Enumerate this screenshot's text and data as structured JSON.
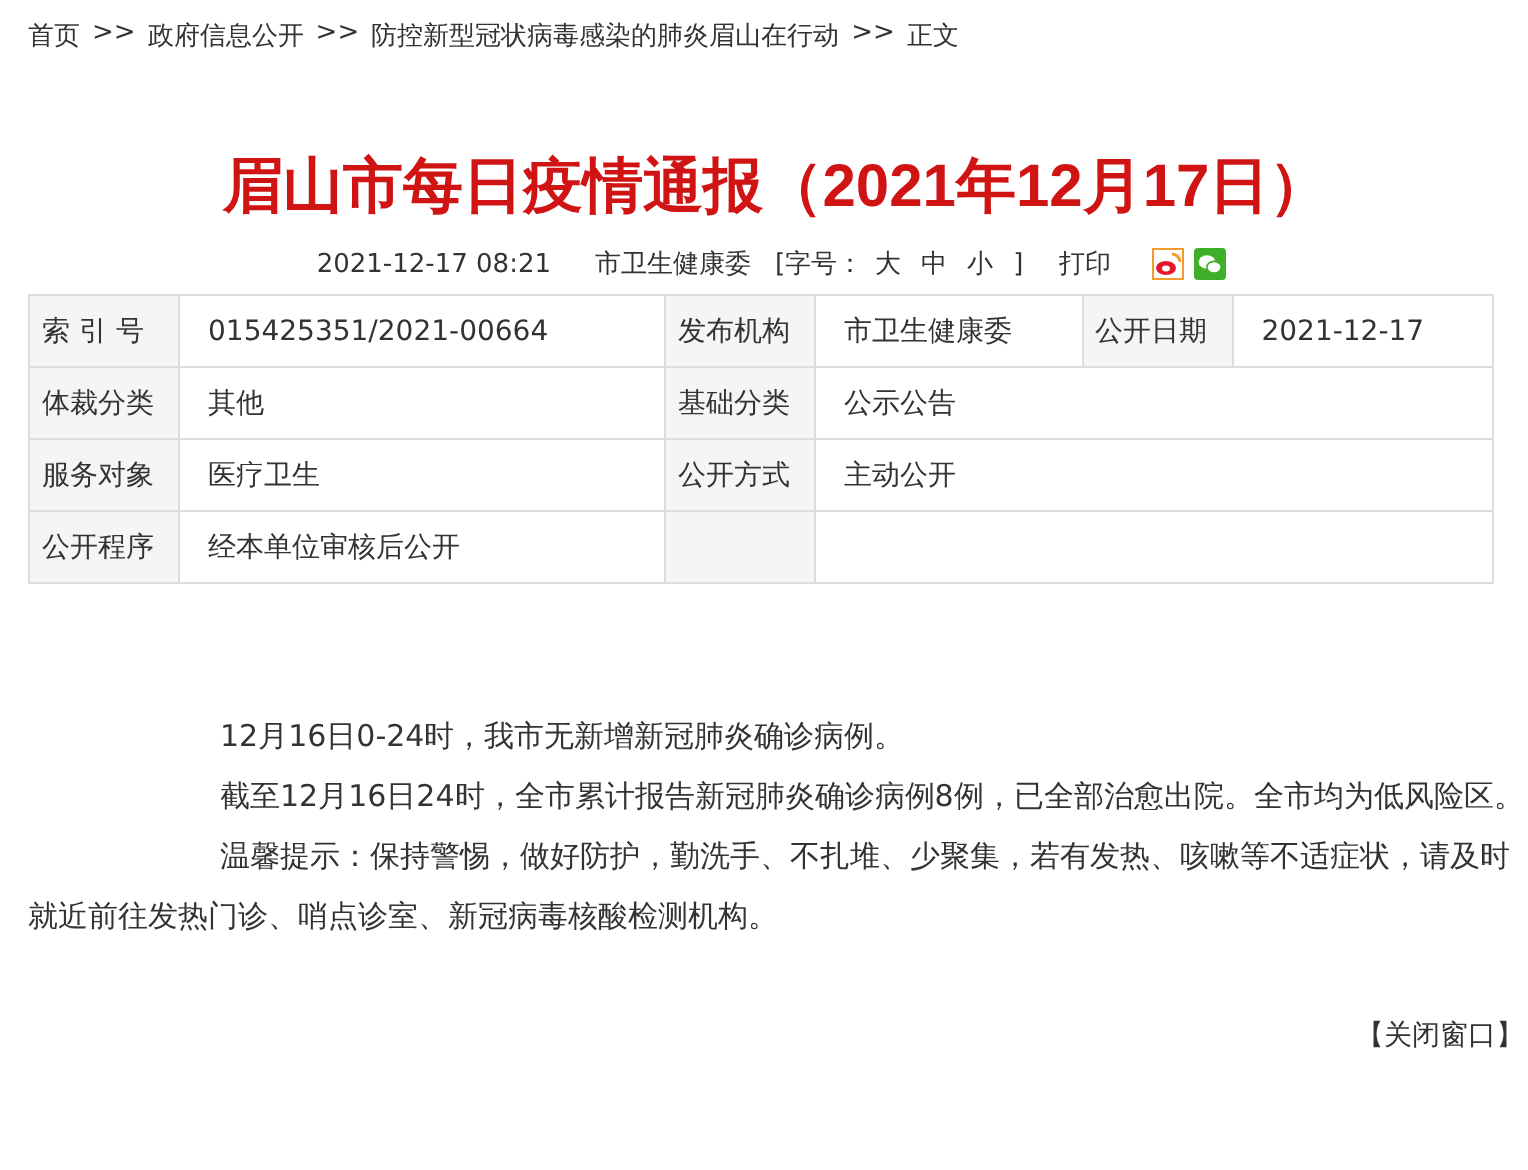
{
  "breadcrumb": [
    "首页",
    "政府信息公开",
    "防控新型冠状病毒感染的肺炎眉山在行动",
    "正文"
  ],
  "breadcrumb_separator": ">>",
  "title": "眉山市每日疫情通报（2021年12月17日）",
  "meta": {
    "datetime": "2021-12-17 08:21",
    "source": "市卫生健康委",
    "font_size_label": "[字号：",
    "font_sizes": [
      "大",
      "中",
      "小"
    ],
    "font_size_end": "]",
    "print": "打印"
  },
  "table": {
    "rows": [
      [
        {
          "kind": "label",
          "text": "索 引 号"
        },
        {
          "kind": "value",
          "text": "015425351/2021-00664"
        },
        {
          "kind": "label",
          "text": "发布机构"
        },
        {
          "kind": "value",
          "text": "市卫生健康委"
        },
        {
          "kind": "label",
          "text": "公开日期"
        },
        {
          "kind": "value",
          "text": "2021-12-17"
        }
      ],
      [
        {
          "kind": "label",
          "text": "体裁分类"
        },
        {
          "kind": "value",
          "text": "其他"
        },
        {
          "kind": "label",
          "text": "基础分类"
        },
        {
          "kind": "value",
          "text": "公示公告",
          "colspan": 3
        }
      ],
      [
        {
          "kind": "label",
          "text": "服务对象"
        },
        {
          "kind": "value",
          "text": "医疗卫生"
        },
        {
          "kind": "label",
          "text": "公开方式"
        },
        {
          "kind": "value",
          "text": "主动公开",
          "colspan": 3
        }
      ],
      [
        {
          "kind": "label",
          "text": "公开程序"
        },
        {
          "kind": "value",
          "text": "经本单位审核后公开"
        }
      ]
    ]
  },
  "paragraphs": [
    "12月16日0-24时，我市无新增新冠肺炎确诊病例。",
    "截至12月16日24时，全市累计报告新冠肺炎确诊病例8例，已全部治愈出院。全市均为低风险区。",
    "温馨提示：保持警惕，做好防护，勤洗手、不扎堆、少聚集，若有发热、咳嗽等不适症状，请及时就近前往发热门诊、哨点诊室、新冠病毒核酸检测机构。"
  ],
  "close_link": "【关闭窗口】"
}
